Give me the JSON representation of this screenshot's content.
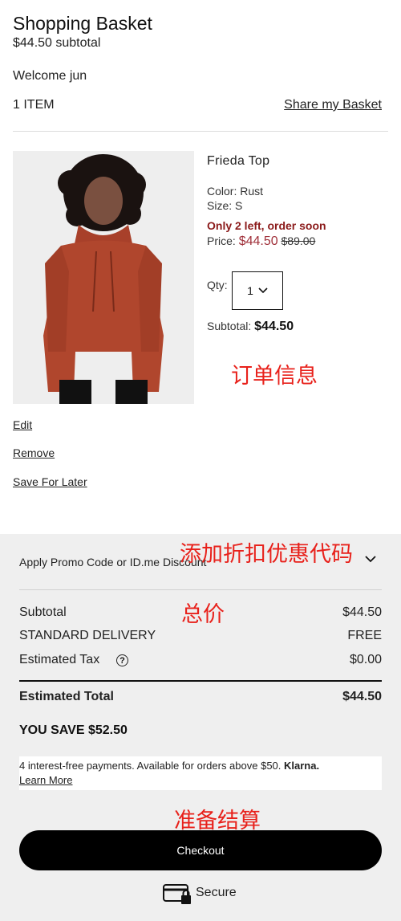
{
  "header": {
    "title": "Shopping Basket",
    "subtotal": "$44.50 subtotal",
    "welcome": "Welcome jun",
    "item_count": "1 ITEM",
    "share_label": "Share my Basket"
  },
  "product": {
    "name": "Frieda Top",
    "color": "Color: Rust",
    "size": "Size: S",
    "stock_notice": "Only 2 left, order soon",
    "price_label": "Price:",
    "sale_price": "$44.50",
    "original_price": "$89.00",
    "qty_label": "Qty:",
    "qty_value": "1",
    "subtotal_label": "Subtotal:",
    "subtotal_value": "$44.50",
    "image_icon": "person-wearing-rust-hoodie"
  },
  "actions": {
    "edit": "Edit",
    "remove": "Remove",
    "save_for_later": "Save For Later"
  },
  "annotations": {
    "order_info": "订单信息",
    "add_promo": "添加折扣优惠代码",
    "total": "总价",
    "prepare_checkout": "准备结算"
  },
  "summary": {
    "promo_label": "Apply Promo Code or ID.me Discount",
    "subtotal_label": "Subtotal",
    "subtotal_value": "$44.50",
    "delivery_label": "STANDARD DELIVERY",
    "delivery_value": "FREE",
    "tax_label": "Estimated Tax",
    "tax_value": "$0.00",
    "total_label": "Estimated Total",
    "total_value": "$44.50",
    "you_save": "YOU SAVE $52.50",
    "klarna_text": "4 interest-free payments. Available for orders above $50.",
    "klarna_brand": "Klarna.",
    "learn_more": "Learn More",
    "checkout_label": "Checkout",
    "secure_label": "Secure"
  },
  "colors": {
    "accent_red": "#e8211b",
    "stock_red": "#8b1a1a",
    "sale_price": "#a0303a",
    "summary_bg": "#efefef",
    "checkout_bg": "#000000"
  }
}
